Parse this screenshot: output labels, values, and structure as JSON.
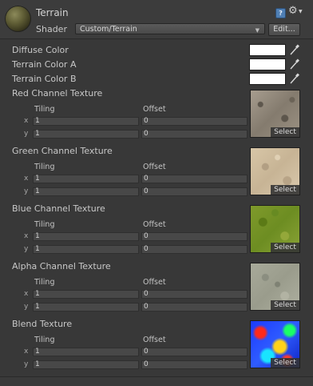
{
  "header": {
    "material_name": "Terrain",
    "shader_label": "Shader",
    "shader_value": "Custom/Terrain",
    "edit_label": "Edit...",
    "help_glyph": "?"
  },
  "colors": [
    {
      "label": "Diffuse Color",
      "value": "#ffffff"
    },
    {
      "label": "Terrain Color A",
      "value": "#ffffff"
    },
    {
      "label": "Terrain Color B",
      "value": "#ffffff"
    }
  ],
  "textures": [
    {
      "label": "Red Channel Texture",
      "tiling_label": "Tiling",
      "offset_label": "Offset",
      "x_label": "x",
      "y_label": "y",
      "tiling_x": "1",
      "tiling_y": "1",
      "offset_x": "0",
      "offset_y": "0",
      "select_label": "Select"
    },
    {
      "label": "Green Channel Texture",
      "tiling_label": "Tiling",
      "offset_label": "Offset",
      "x_label": "x",
      "y_label": "y",
      "tiling_x": "1",
      "tiling_y": "1",
      "offset_x": "0",
      "offset_y": "0",
      "select_label": "Select"
    },
    {
      "label": "Blue Channel Texture",
      "tiling_label": "Tiling",
      "offset_label": "Offset",
      "x_label": "x",
      "y_label": "y",
      "tiling_x": "1",
      "tiling_y": "1",
      "offset_x": "0",
      "offset_y": "0",
      "select_label": "Select"
    },
    {
      "label": "Alpha Channel Texture",
      "tiling_label": "Tiling",
      "offset_label": "Offset",
      "x_label": "x",
      "y_label": "y",
      "tiling_x": "1",
      "tiling_y": "1",
      "offset_x": "0",
      "offset_y": "0",
      "select_label": "Select"
    },
    {
      "label": "Blend Texture",
      "tiling_label": "Tiling",
      "offset_label": "Offset",
      "x_label": "x",
      "y_label": "y",
      "tiling_x": "1",
      "tiling_y": "1",
      "offset_x": "0",
      "offset_y": "0",
      "select_label": "Select"
    }
  ]
}
